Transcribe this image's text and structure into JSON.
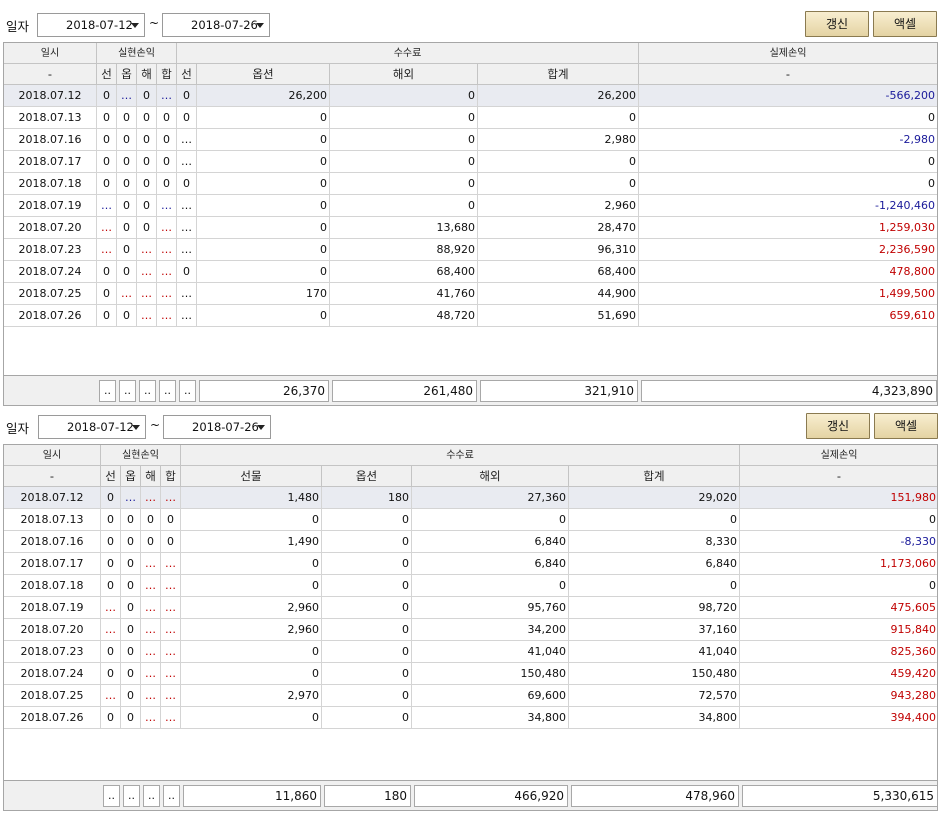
{
  "colors": {
    "negative": "#1a1a9a",
    "positive": "#c00000",
    "dots_red": "#c00000",
    "dots_blue": "#1a1a9a",
    "accent_button": "#e4d3a3"
  },
  "panel1": {
    "toolbar": {
      "date_label": "일자",
      "date_from": "2018-07-12",
      "tilde": "~",
      "date_to": "2018-07-26",
      "refresh_label": "갱신",
      "excel_label": "액셀"
    },
    "columns": [
      "일시",
      "선",
      "옵",
      "해",
      "합",
      "선",
      "옵션",
      "해외",
      "합계",
      "실제손익"
    ],
    "groups": {
      "realized": "실현손익",
      "fee": "수수료",
      "actual": "실제손익"
    },
    "subheaders": {
      "date": "-",
      "option": "옵션",
      "overseas": "해외",
      "total": "합계",
      "actual": "-"
    },
    "rows": [
      [
        "2018.07.12",
        "0",
        "…",
        "0",
        "…",
        "0",
        "26,200",
        "0",
        "26,200",
        "-566,200"
      ],
      [
        "2018.07.13",
        "0",
        "0",
        "0",
        "0",
        "0",
        "0",
        "0",
        "0",
        "0"
      ],
      [
        "2018.07.16",
        "0",
        "0",
        "0",
        "0",
        "…",
        "0",
        "0",
        "2,980",
        "-2,980"
      ],
      [
        "2018.07.17",
        "0",
        "0",
        "0",
        "0",
        "…",
        "0",
        "0",
        "0",
        "0"
      ],
      [
        "2018.07.18",
        "0",
        "0",
        "0",
        "0",
        "0",
        "0",
        "0",
        "0",
        "0"
      ],
      [
        "2018.07.19",
        "…",
        "0",
        "0",
        "…",
        "…",
        "0",
        "0",
        "2,960",
        "-1,240,460"
      ],
      [
        "2018.07.20",
        "…",
        "0",
        "0",
        "…",
        "…",
        "0",
        "13,680",
        "28,470",
        "1,259,030"
      ],
      [
        "2018.07.23",
        "…",
        "0",
        "…",
        "…",
        "…",
        "0",
        "88,920",
        "96,310",
        "2,236,590"
      ],
      [
        "2018.07.24",
        "0",
        "0",
        "…",
        "…",
        "0",
        "0",
        "68,400",
        "68,400",
        "478,800"
      ],
      [
        "2018.07.25",
        "0",
        "…",
        "…",
        "…",
        "…",
        "170",
        "41,760",
        "44,900",
        "1,499,500"
      ],
      [
        "2018.07.26",
        "0",
        "0",
        "…",
        "…",
        "…",
        "0",
        "48,720",
        "51,690",
        "659,610"
      ]
    ],
    "footer": {
      "s1": "..",
      "s2": "..",
      "s3": "..",
      "s4": "..",
      "s5": "..",
      "option": "26,370",
      "overseas": "261,480",
      "total": "321,910",
      "actual": "4,323,890"
    }
  },
  "panel2": {
    "toolbar": {
      "date_label": "일자",
      "date_from": "2018-07-12",
      "tilde": "~",
      "date_to": "2018-07-26",
      "refresh_label": "갱신",
      "excel_label": "액셀"
    },
    "groups": {
      "realized": "실현손익",
      "fee": "수수료",
      "actual": "실제손익"
    },
    "columns": [
      "일시",
      "선",
      "옵",
      "해",
      "합",
      "선물",
      "옵션",
      "해외",
      "합계",
      "실제손익"
    ],
    "subheaders": {
      "date": "-",
      "futures": "선물",
      "option": "옵션",
      "overseas": "해외",
      "total": "합계",
      "actual": "-"
    },
    "rows": [
      [
        "2018.07.12",
        "0",
        "…",
        "…",
        "…",
        "1,480",
        "180",
        "27,360",
        "29,020",
        "151,980"
      ],
      [
        "2018.07.13",
        "0",
        "0",
        "0",
        "0",
        "0",
        "0",
        "0",
        "0",
        "0"
      ],
      [
        "2018.07.16",
        "0",
        "0",
        "0",
        "0",
        "1,490",
        "0",
        "6,840",
        "8,330",
        "-8,330"
      ],
      [
        "2018.07.17",
        "0",
        "0",
        "…",
        "…",
        "0",
        "0",
        "6,840",
        "6,840",
        "1,173,060"
      ],
      [
        "2018.07.18",
        "0",
        "0",
        "…",
        "…",
        "0",
        "0",
        "0",
        "0",
        "0"
      ],
      [
        "2018.07.19",
        "…",
        "0",
        "…",
        "…",
        "2,960",
        "0",
        "95,760",
        "98,720",
        "475,605"
      ],
      [
        "2018.07.20",
        "…",
        "0",
        "…",
        "…",
        "2,960",
        "0",
        "34,200",
        "37,160",
        "915,840"
      ],
      [
        "2018.07.23",
        "0",
        "0",
        "…",
        "…",
        "0",
        "0",
        "41,040",
        "41,040",
        "825,360"
      ],
      [
        "2018.07.24",
        "0",
        "0",
        "…",
        "…",
        "0",
        "0",
        "150,480",
        "150,480",
        "459,420"
      ],
      [
        "2018.07.25",
        "…",
        "0",
        "…",
        "…",
        "2,970",
        "0",
        "69,600",
        "72,570",
        "943,280"
      ],
      [
        "2018.07.26",
        "0",
        "0",
        "…",
        "…",
        "0",
        "0",
        "34,800",
        "34,800",
        "394,400"
      ]
    ],
    "footer": {
      "s1": "..",
      "s2": "..",
      "s3": "..",
      "s4": "..",
      "futures": "11,860",
      "option": "180",
      "overseas": "466,920",
      "total": "478,960",
      "actual": "5,330,615"
    }
  }
}
